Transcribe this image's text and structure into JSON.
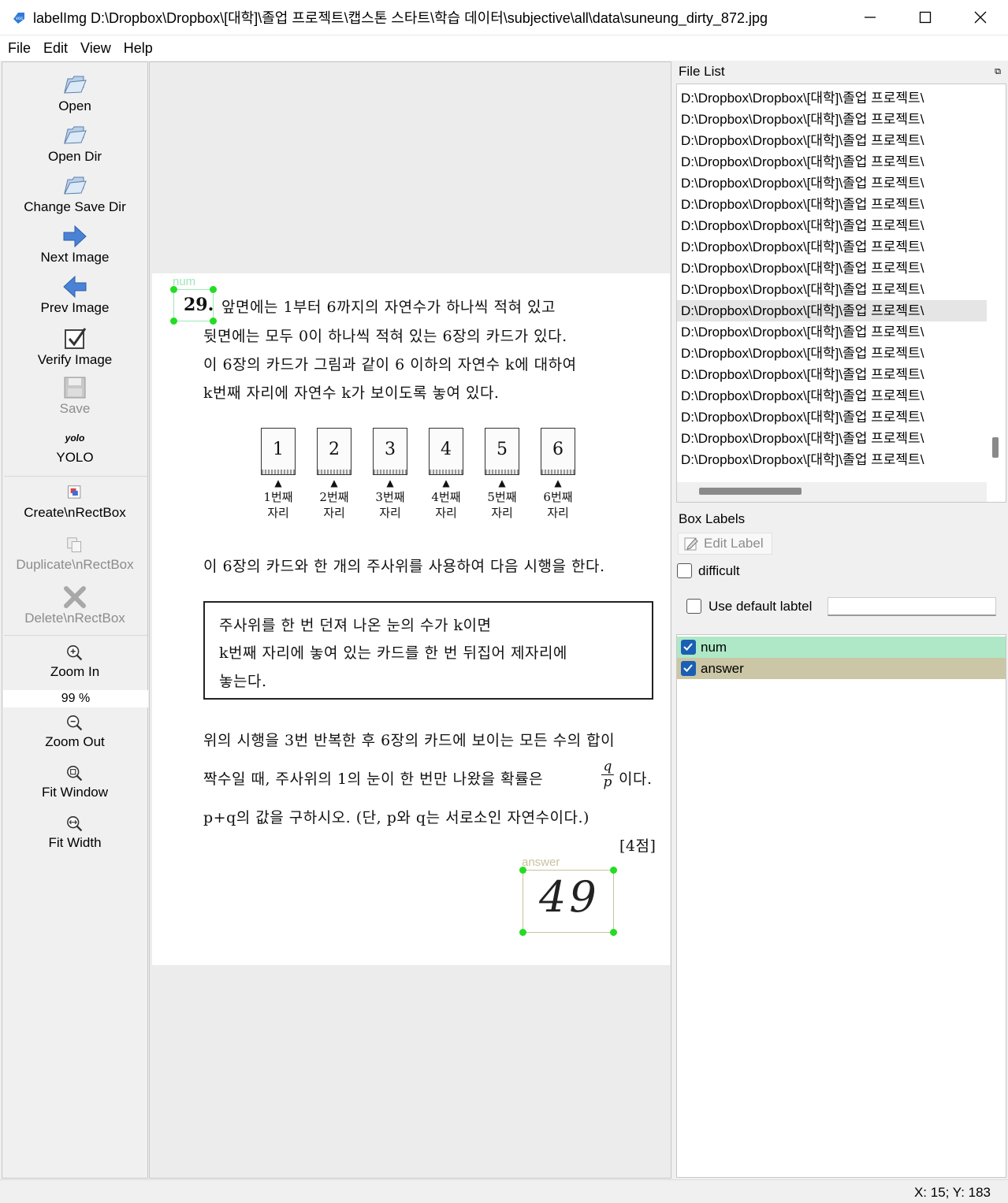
{
  "window": {
    "title": "labelImg D:\\Dropbox\\Dropbox\\[대학]\\졸업 프로젝트\\캡스톤 스타트\\학습 데이터\\subjective\\all\\data\\suneung_dirty_872.jpg",
    "minimize_icon": "minimize-icon",
    "maximize_icon": "maximize-icon",
    "close_icon": "close-icon"
  },
  "menu": {
    "file": "File",
    "edit": "Edit",
    "view": "View",
    "help": "Help"
  },
  "toolbar": {
    "open": "Open",
    "open_dir": "Open Dir",
    "change_save_dir": "Change Save Dir",
    "next_image": "Next Image",
    "prev_image": "Prev Image",
    "verify_image": "Verify Image",
    "save": "Save",
    "format_icon_text": "yolo",
    "format": "YOLO",
    "create_rect": "Create\\nRectBox",
    "duplicate_rect": "Duplicate\\nRectBox",
    "delete_rect": "Delete\\nRectBox",
    "zoom_in": "Zoom In",
    "zoom_value": "99 %",
    "zoom_out": "Zoom Out",
    "fit_window": "Fit Window",
    "fit_width": "Fit Width"
  },
  "document": {
    "question_number": "29.",
    "lines": [
      "앞면에는 1부터 6까지의 자연수가 하나씩 적혀 있고",
      "뒷면에는 모두 0이 하나씩 적혀 있는 6장의 카드가 있다.",
      "이 6장의 카드가 그림과 같이 6 이하의 자연수 k에 대하여",
      "k번째 자리에 자연수 k가 보이도록 놓여 있다."
    ],
    "cards": [
      "1",
      "2",
      "3",
      "4",
      "5",
      "6"
    ],
    "slots_top": [
      "1번째",
      "2번째",
      "3번째",
      "4번째",
      "5번째",
      "6번째"
    ],
    "slot_bottom": "자리",
    "after_cards": "이 6장의 카드와 한 개의 주사위를 사용하여 다음 시행을 한다.",
    "box_lines": [
      "주사위를 한 번 던져 나온 눈의 수가 k이면",
      "k번째 자리에 놓여 있는 카드를 한 번 뒤집어 제자리에",
      "놓는다."
    ],
    "para_lines": [
      "위의 시행을 3번 반복한 후 6장의 카드에 보이는 모든 수의 합이",
      "짝수일 때, 주사위의 1의 눈이 한 번만 나왔을 확률은",
      "p+q의 값을 구하시오. (단, p와 q는 서로소인 자연수이다.)"
    ],
    "fraction_num": "q",
    "fraction_den": "p",
    "fraction_tail": "이다.",
    "points": "[4점]",
    "handwritten_answer": "49"
  },
  "annotations": [
    {
      "label": "num",
      "color": "#9fe8b8"
    },
    {
      "label": "answer",
      "color": "#c9c2a0"
    }
  ],
  "file_list": {
    "header": "File List",
    "items": [
      "D:\\Dropbox\\Dropbox\\[대학]\\졸업 프로젝트\\",
      "D:\\Dropbox\\Dropbox\\[대학]\\졸업 프로젝트\\",
      "D:\\Dropbox\\Dropbox\\[대학]\\졸업 프로젝트\\",
      "D:\\Dropbox\\Dropbox\\[대학]\\졸업 프로젝트\\",
      "D:\\Dropbox\\Dropbox\\[대학]\\졸업 프로젝트\\",
      "D:\\Dropbox\\Dropbox\\[대학]\\졸업 프로젝트\\",
      "D:\\Dropbox\\Dropbox\\[대학]\\졸업 프로젝트\\",
      "D:\\Dropbox\\Dropbox\\[대학]\\졸업 프로젝트\\",
      "D:\\Dropbox\\Dropbox\\[대학]\\졸업 프로젝트\\",
      "D:\\Dropbox\\Dropbox\\[대학]\\졸업 프로젝트\\",
      "D:\\Dropbox\\Dropbox\\[대학]\\졸업 프로젝트\\",
      "D:\\Dropbox\\Dropbox\\[대학]\\졸업 프로젝트\\",
      "D:\\Dropbox\\Dropbox\\[대학]\\졸업 프로젝트\\",
      "D:\\Dropbox\\Dropbox\\[대학]\\졸업 프로젝트\\",
      "D:\\Dropbox\\Dropbox\\[대학]\\졸업 프로젝트\\",
      "D:\\Dropbox\\Dropbox\\[대학]\\졸업 프로젝트\\",
      "D:\\Dropbox\\Dropbox\\[대학]\\졸업 프로젝트\\",
      "D:\\Dropbox\\Dropbox\\[대학]\\졸업 프로젝트\\"
    ],
    "selected_index": 10
  },
  "box_labels": {
    "header": "Box Labels",
    "edit_label": "Edit Label",
    "difficult": "difficult",
    "use_default": "Use default labtel",
    "default_value": "",
    "labels": [
      {
        "name": "num",
        "checked": true,
        "color": "#aee8c6"
      },
      {
        "name": "answer",
        "checked": true,
        "color": "#cbc6a6"
      }
    ]
  },
  "status": "X: 15; Y: 183"
}
